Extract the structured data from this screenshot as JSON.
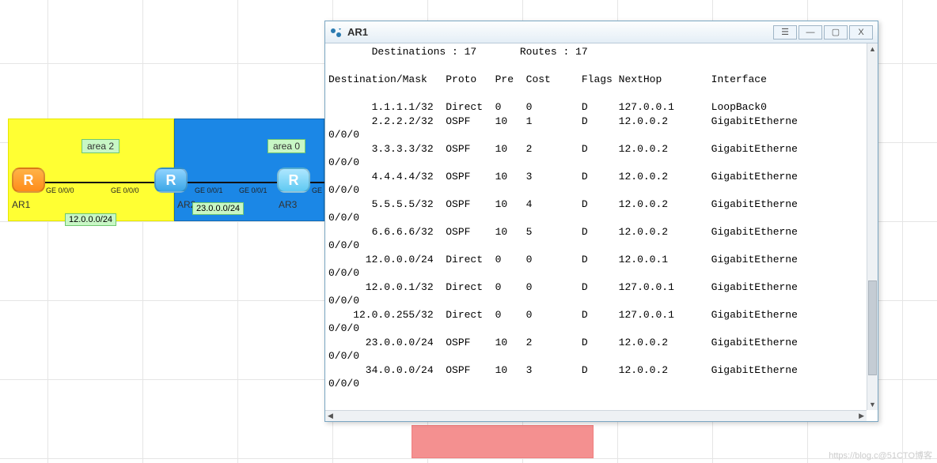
{
  "window": {
    "title": "AR1",
    "buttons": {
      "menu": "☰",
      "min": "—",
      "max": "▢",
      "close": "X"
    }
  },
  "topology": {
    "area2_label": "area 2",
    "area0_label": "area 0",
    "routers": {
      "ar1": "AR1",
      "ar2": "AR2",
      "ar3": "AR3"
    },
    "router_glyph": "R",
    "ports": {
      "ar1_right": "GE 0/0/0",
      "ar2_left": "GE 0/0/0",
      "ar2_right": "GE 0/0/1",
      "ar3_left": "GE 0/0/1",
      "ar3_right": "GE"
    },
    "subnets": {
      "s12": "12.0.0.0/24",
      "s23": "23.0.0.0/24"
    }
  },
  "terminal": {
    "summary": "       Destinations : 17       Routes : 17",
    "headers": {
      "dest": "Destination/Mask",
      "proto": "Proto",
      "pre": "Pre",
      "cost": "Cost",
      "flags": "Flags",
      "nexthop": "NextHop",
      "iface": "Interface"
    },
    "wrap": "0/0/0",
    "rows": [
      {
        "dest": "1.1.1.1/32",
        "proto": "Direct",
        "pre": "0",
        "cost": "0",
        "flags": "D",
        "nexthop": "127.0.0.1",
        "iface": "LoopBack0",
        "wrap": false
      },
      {
        "dest": "2.2.2.2/32",
        "proto": "OSPF",
        "pre": "10",
        "cost": "1",
        "flags": "D",
        "nexthop": "12.0.0.2",
        "iface": "GigabitEtherne",
        "wrap": true
      },
      {
        "dest": "3.3.3.3/32",
        "proto": "OSPF",
        "pre": "10",
        "cost": "2",
        "flags": "D",
        "nexthop": "12.0.0.2",
        "iface": "GigabitEtherne",
        "wrap": true
      },
      {
        "dest": "4.4.4.4/32",
        "proto": "OSPF",
        "pre": "10",
        "cost": "3",
        "flags": "D",
        "nexthop": "12.0.0.2",
        "iface": "GigabitEtherne",
        "wrap": true
      },
      {
        "dest": "5.5.5.5/32",
        "proto": "OSPF",
        "pre": "10",
        "cost": "4",
        "flags": "D",
        "nexthop": "12.0.0.2",
        "iface": "GigabitEtherne",
        "wrap": true
      },
      {
        "dest": "6.6.6.6/32",
        "proto": "OSPF",
        "pre": "10",
        "cost": "5",
        "flags": "D",
        "nexthop": "12.0.0.2",
        "iface": "GigabitEtherne",
        "wrap": true
      },
      {
        "dest": "12.0.0.0/24",
        "proto": "Direct",
        "pre": "0",
        "cost": "0",
        "flags": "D",
        "nexthop": "12.0.0.1",
        "iface": "GigabitEtherne",
        "wrap": true
      },
      {
        "dest": "12.0.0.1/32",
        "proto": "Direct",
        "pre": "0",
        "cost": "0",
        "flags": "D",
        "nexthop": "127.0.0.1",
        "iface": "GigabitEtherne",
        "wrap": true
      },
      {
        "dest": "12.0.0.255/32",
        "proto": "Direct",
        "pre": "0",
        "cost": "0",
        "flags": "D",
        "nexthop": "127.0.0.1",
        "iface": "GigabitEtherne",
        "wrap": true
      },
      {
        "dest": "23.0.0.0/24",
        "proto": "OSPF",
        "pre": "10",
        "cost": "2",
        "flags": "D",
        "nexthop": "12.0.0.2",
        "iface": "GigabitEtherne",
        "wrap": true
      },
      {
        "dest": "34.0.0.0/24",
        "proto": "OSPF",
        "pre": "10",
        "cost": "3",
        "flags": "D",
        "nexthop": "12.0.0.2",
        "iface": "GigabitEtherne",
        "wrap": true
      }
    ]
  },
  "watermark": "https://blog.c@51CTO博客"
}
